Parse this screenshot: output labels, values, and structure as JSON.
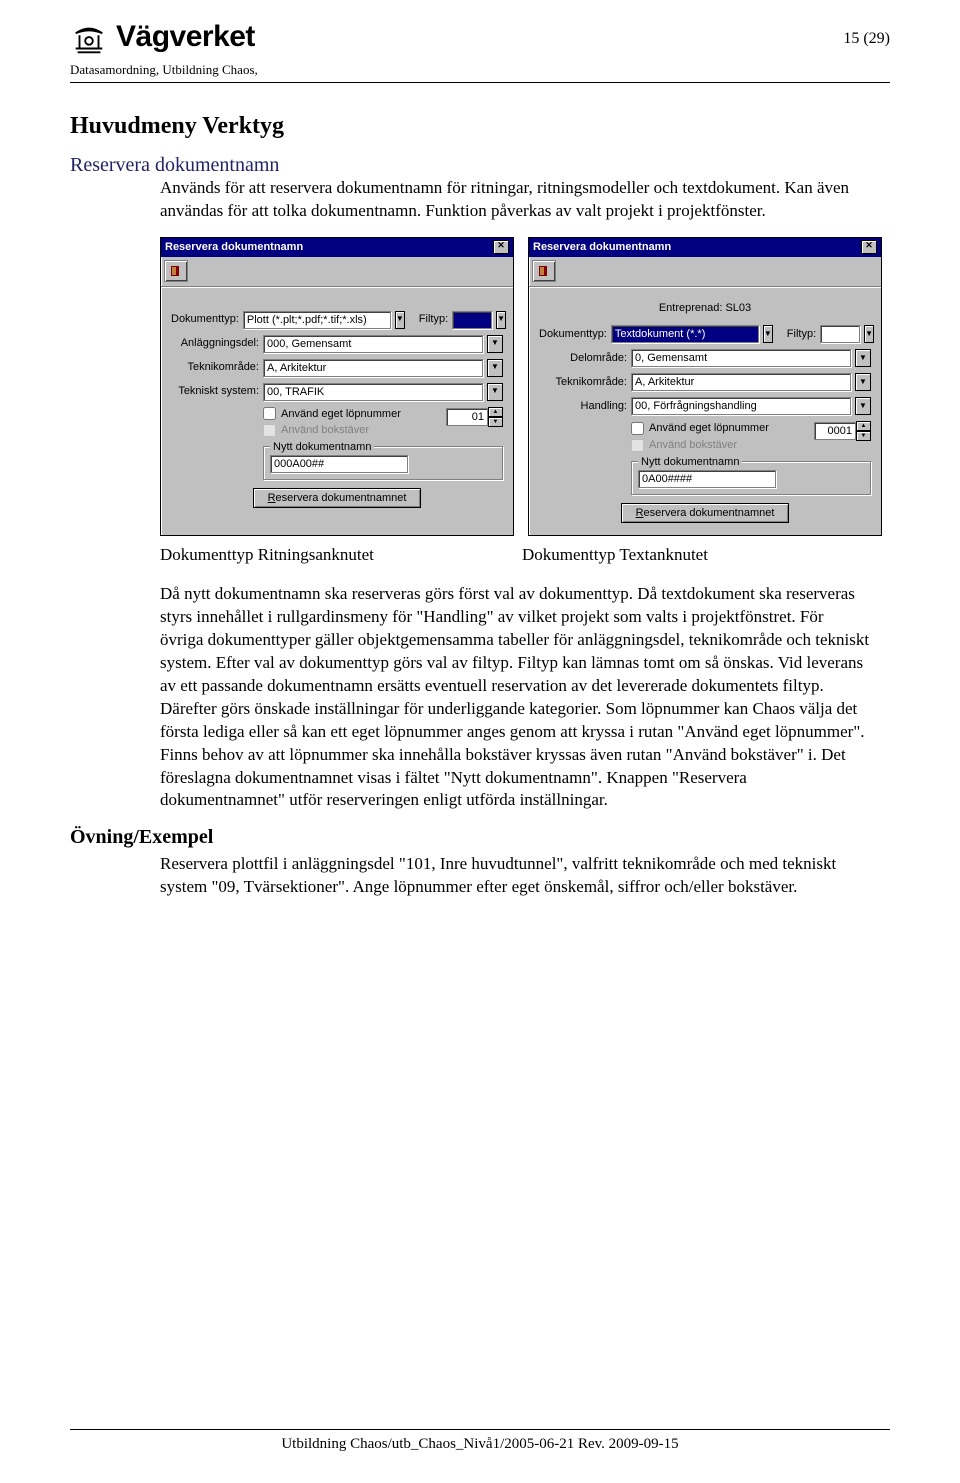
{
  "header": {
    "brand": "Vägverket",
    "page_counter": "15 (29)",
    "subline": "Datasamordning, Utbildning Chaos,"
  },
  "section": {
    "h2": "Huvudmeny Verktyg",
    "item": "Reservera dokumentnamn",
    "intro": "Används för att reservera dokumentnamn för ritningar, ritningsmodeller och textdokument. Kan även användas för att tolka dokumentnamn. Funktion påverkas av valt projekt i projektfönster."
  },
  "dialogA": {
    "title": "Reservera dokumentnamn",
    "labels": {
      "dokumenttyp": "Dokumenttyp:",
      "filtyp": "Filtyp:",
      "anlaggningsdel": "Anläggningsdel:",
      "teknikomrade": "Teknikområde:",
      "tekniskt_system": "Tekniskt system:",
      "use_own": "Använd eget löpnummer",
      "use_letters": "Använd bokstäver",
      "group_legend": "Nytt dokumentnamn",
      "button": "Reservera  dokumentnamnet",
      "button_mnemonic": "R"
    },
    "values": {
      "dokumenttyp": "Plott (*.plt;*.pdf;*.tif;*.xls)",
      "filtyp": "",
      "anlaggningsdel": "000, Gemensamt",
      "teknikomrade": "A, Arkitektur",
      "tekniskt_system": "00, TRAFIK",
      "lopnummer": "01",
      "new_name": "000A00##"
    }
  },
  "dialogB": {
    "title": "Reservera dokumentnamn",
    "entreprenad": "Entreprenad: SL03",
    "labels": {
      "dokumenttyp": "Dokumenttyp:",
      "filtyp": "Filtyp:",
      "delomrade": "Delområde:",
      "teknikomrade": "Teknikområde:",
      "handling": "Handling:",
      "use_own": "Använd eget löpnummer",
      "use_letters": "Använd bokstäver",
      "group_legend": "Nytt dokumentnamn",
      "button": "Reservera  dokumentnamnet",
      "button_mnemonic": "R"
    },
    "values": {
      "dokumenttyp": "Textdokument (*.*)",
      "filtyp": "",
      "delomrade": "0, Gemensamt",
      "teknikomrade": "A, Arkitektur",
      "handling": "00, Förfrågningshandling",
      "lopnummer": "0001",
      "new_name": "0A00####"
    }
  },
  "captions": {
    "left": "Dokumenttyp Ritningsanknutet",
    "right": "Dokumenttyp Textanknutet"
  },
  "body_main": "Då nytt dokumentnamn ska reserveras görs först val av dokumenttyp. Då textdokument ska reserveras styrs innehållet i rullgardinsmeny för \"Handling\" av vilket projekt som valts i projektfönstret. För övriga dokumenttyper gäller objektgemensamma tabeller för anläggningsdel, teknikområde och tekniskt system. Efter val av dokumenttyp görs val av filtyp. Filtyp kan lämnas tomt om så önskas. Vid leverans av ett passande dokumentnamn ersätts eventuell reservation av det levererade dokumentets filtyp. Därefter görs önskade inställningar för underliggande kategorier. Som löpnummer kan Chaos välja det första lediga eller så kan ett eget löpnummer anges genom att kryssa i rutan \"Använd eget löpnummer\". Finns behov av att löpnummer ska innehålla bokstäver kryssas även rutan \"Använd bokstäver\" i. Det föreslagna dokumentnamnet visas i fältet \"Nytt dokumentnamn\". Knappen \"Reservera dokumentnamnet\" utför reserveringen enligt utförda inställningar.",
  "exempel": {
    "label": "Övning/Exempel",
    "text": "Reservera plottfil i anläggningsdel \"101, Inre huvudtunnel\", valfritt teknikområde och med tekniskt system \"09, Tvärsektioner\". Ange löpnummer efter eget önskemål, siffror och/eller bokstäver."
  },
  "footer": "Utbildning Chaos/utb_Chaos_Nivå1/2005-06-21 Rev. 2009-09-15"
}
